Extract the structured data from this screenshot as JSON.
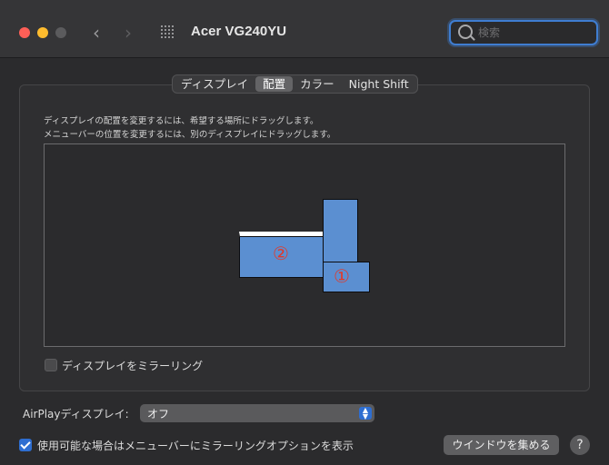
{
  "window": {
    "title": "Acer VG240YU",
    "nav_back": "‹",
    "nav_forward": "›"
  },
  "search": {
    "placeholder": "検索",
    "value": ""
  },
  "tabs": [
    {
      "label": "ディスプレイ",
      "active": false
    },
    {
      "label": "配置",
      "active": true
    },
    {
      "label": "カラー",
      "active": false
    },
    {
      "label": "Night Shift",
      "active": false
    }
  ],
  "arrangement": {
    "description_line1": "ディスプレイの配置を変更するには、希望する場所にドラッグします。",
    "description_line2": "メニューバーの位置を変更するには、別のディスプレイにドラッグします。",
    "display_main_label": "②",
    "display_secondary_label": "①",
    "display_color": "#5b8fd1",
    "menubar_color": "#ffffff",
    "number_color": "#e03a2b"
  },
  "mirror": {
    "label": "ディスプレイをミラーリング",
    "checked": false
  },
  "airplay": {
    "label": "AirPlayディスプレイ:",
    "value": "オフ"
  },
  "menu_option": {
    "label": "使用可能な場合はメニューバーにミラーリングオプションを表示",
    "checked": true
  },
  "buttons": {
    "gather_windows": "ウインドウを集める",
    "help": "?"
  },
  "colors": {
    "accent": "#2e6ed1",
    "close": "#ff5f57",
    "minimize": "#febc2e"
  }
}
